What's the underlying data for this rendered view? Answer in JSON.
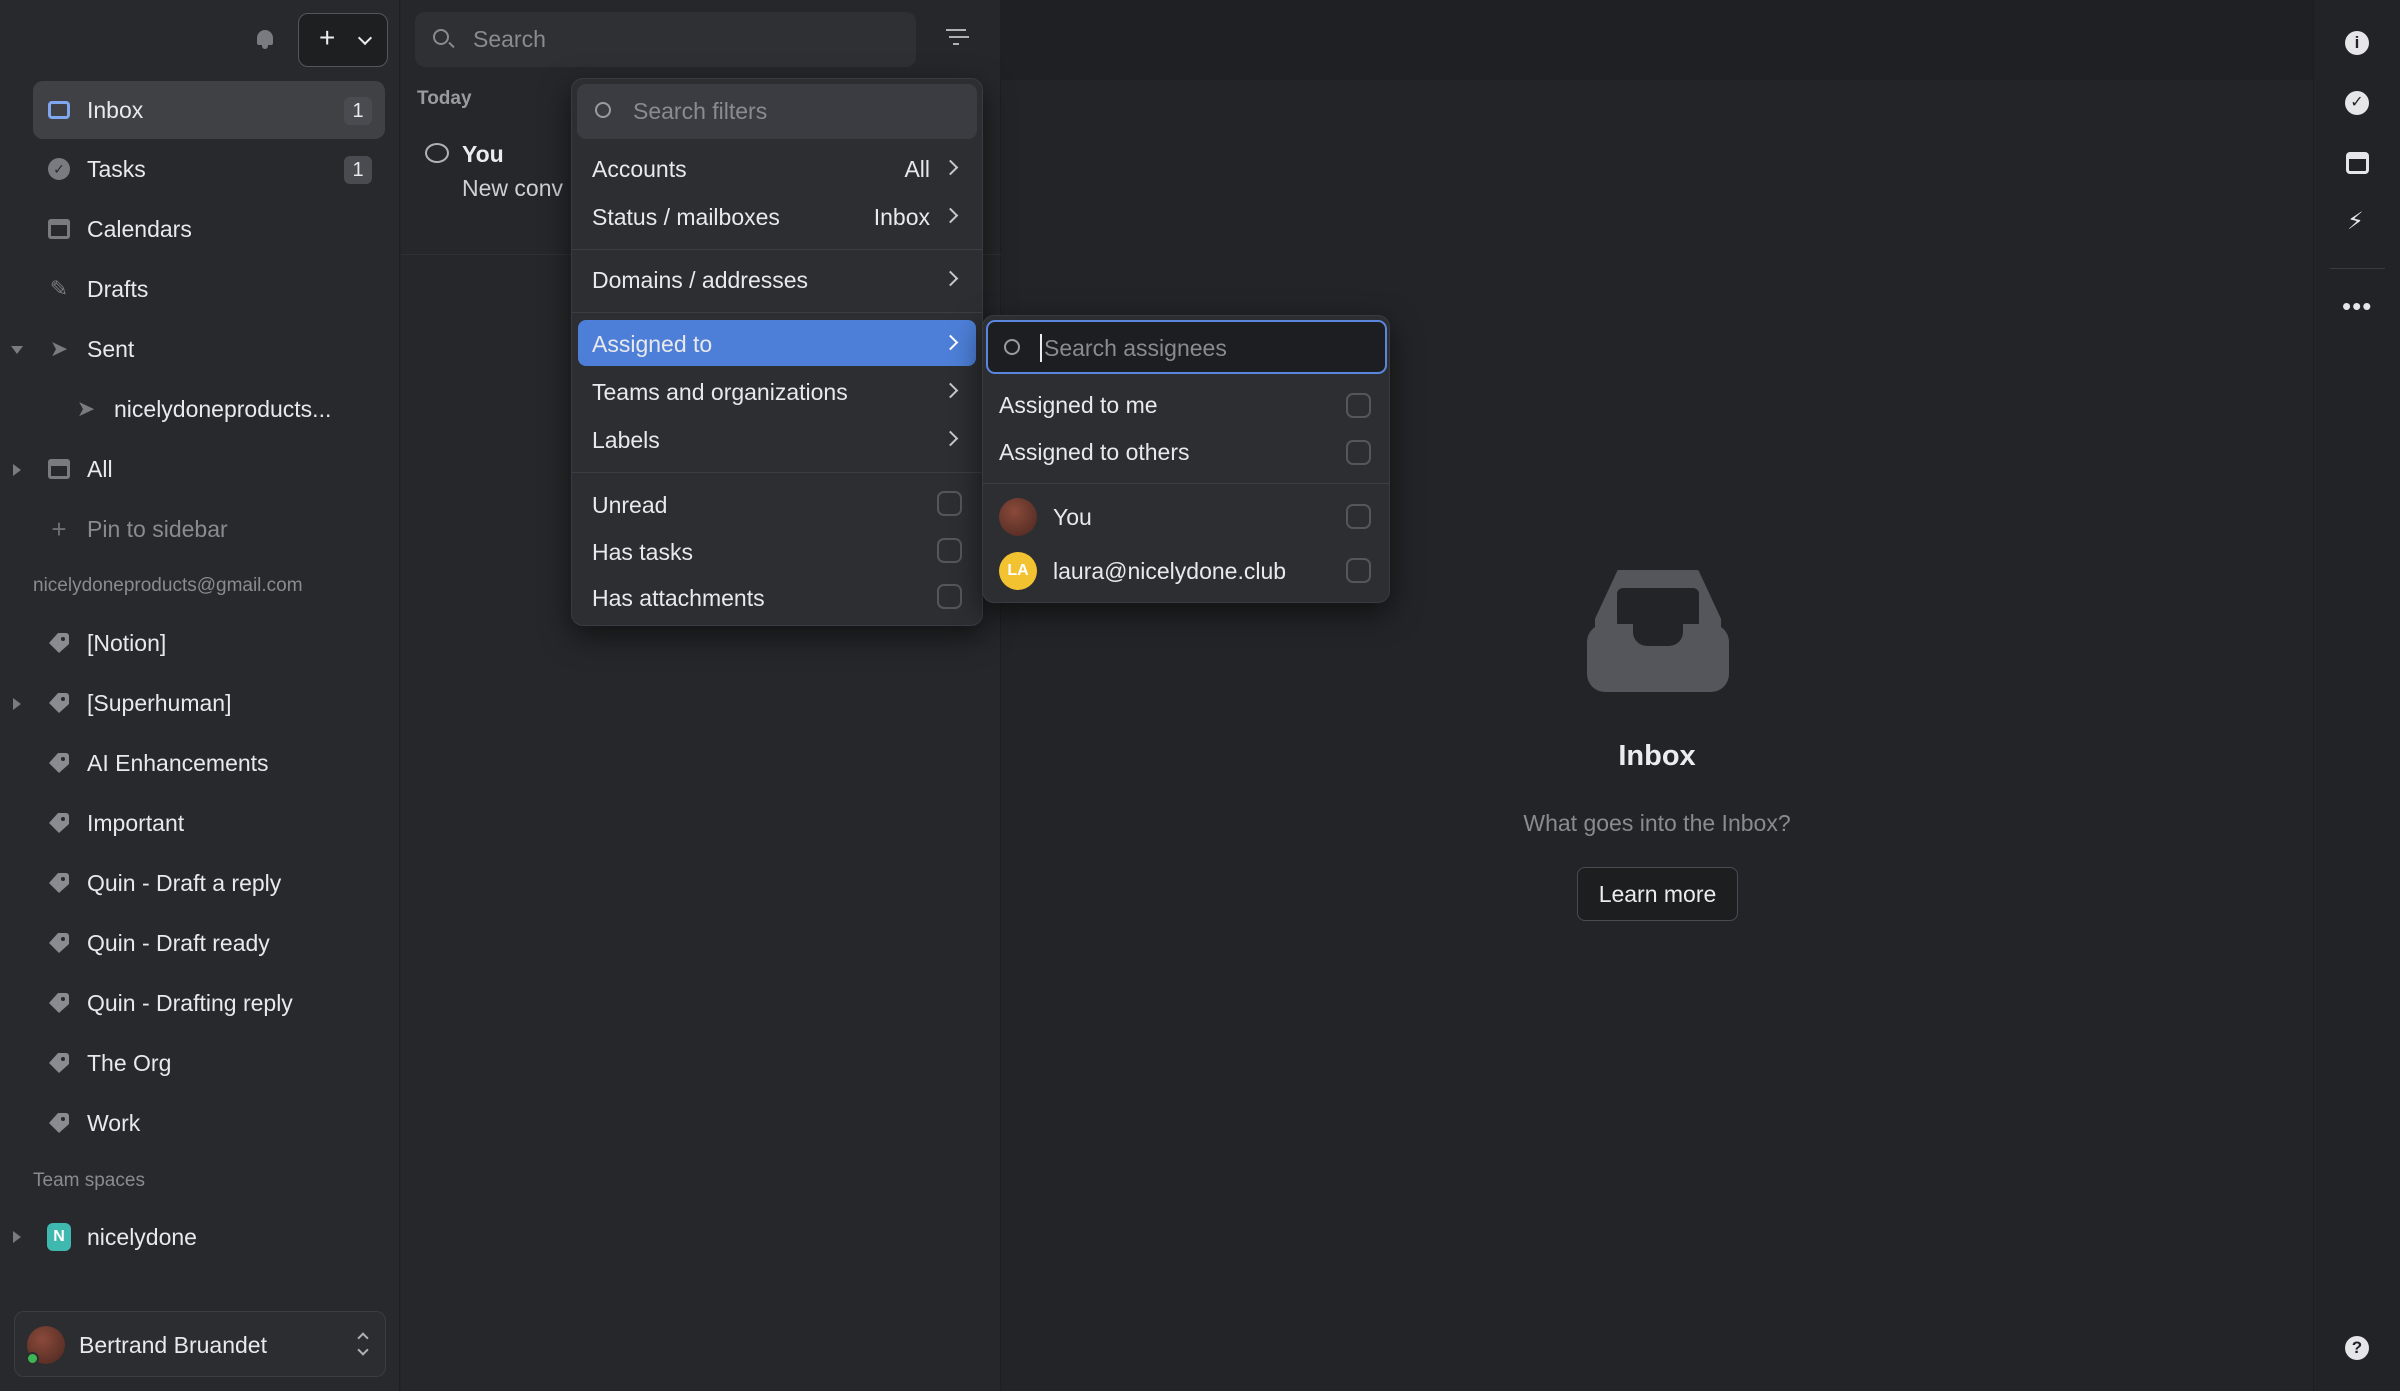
{
  "sidebar": {
    "items": [
      {
        "label": "Inbox",
        "badge": "1"
      },
      {
        "label": "Tasks",
        "badge": "1"
      },
      {
        "label": "Calendars"
      },
      {
        "label": "Drafts"
      },
      {
        "label": "Sent"
      },
      {
        "label": "nicelydoneproducts..."
      },
      {
        "label": "All"
      },
      {
        "label": "Pin to sidebar"
      }
    ],
    "account_email": "nicelydoneproducts@gmail.com",
    "labels": [
      "[Notion]",
      "[Superhuman]",
      "AI Enhancements",
      "Important",
      "Quin - Draft a reply",
      "Quin - Draft ready",
      "Quin - Drafting reply",
      "The Org",
      "Work"
    ],
    "team_spaces_header": "Team spaces",
    "team": {
      "initial": "N",
      "name": "nicelydone"
    },
    "user": {
      "name": "Bertrand Bruandet"
    }
  },
  "search": {
    "placeholder": "Search"
  },
  "list": {
    "group_header": "Today",
    "items": [
      {
        "sender": "You",
        "preview": "New conv"
      }
    ]
  },
  "filter_menu": {
    "search_placeholder": "Search filters",
    "rows": [
      {
        "label": "Accounts",
        "value": "All"
      },
      {
        "label": "Status / mailboxes",
        "value": "Inbox"
      },
      {
        "label": "Domains / addresses"
      },
      {
        "label": "Assigned to"
      },
      {
        "label": "Teams and organizations"
      },
      {
        "label": "Labels"
      },
      {
        "label": "Unread"
      },
      {
        "label": "Has tasks"
      },
      {
        "label": "Has attachments"
      }
    ]
  },
  "assignee_menu": {
    "search_placeholder": "Search assignees",
    "options": [
      {
        "label": "Assigned to me"
      },
      {
        "label": "Assigned to others"
      },
      {
        "label": "You"
      },
      {
        "label": "laura@nicelydone.club",
        "initials": "LA"
      }
    ]
  },
  "empty_state": {
    "title": "Inbox",
    "subtitle": "What goes into the Inbox?",
    "button": "Learn more"
  },
  "colors": {
    "accent": "#4d7fd8",
    "team_badge": "#3fb8af",
    "avatar_la": "#f2c230",
    "online": "#3db553"
  }
}
